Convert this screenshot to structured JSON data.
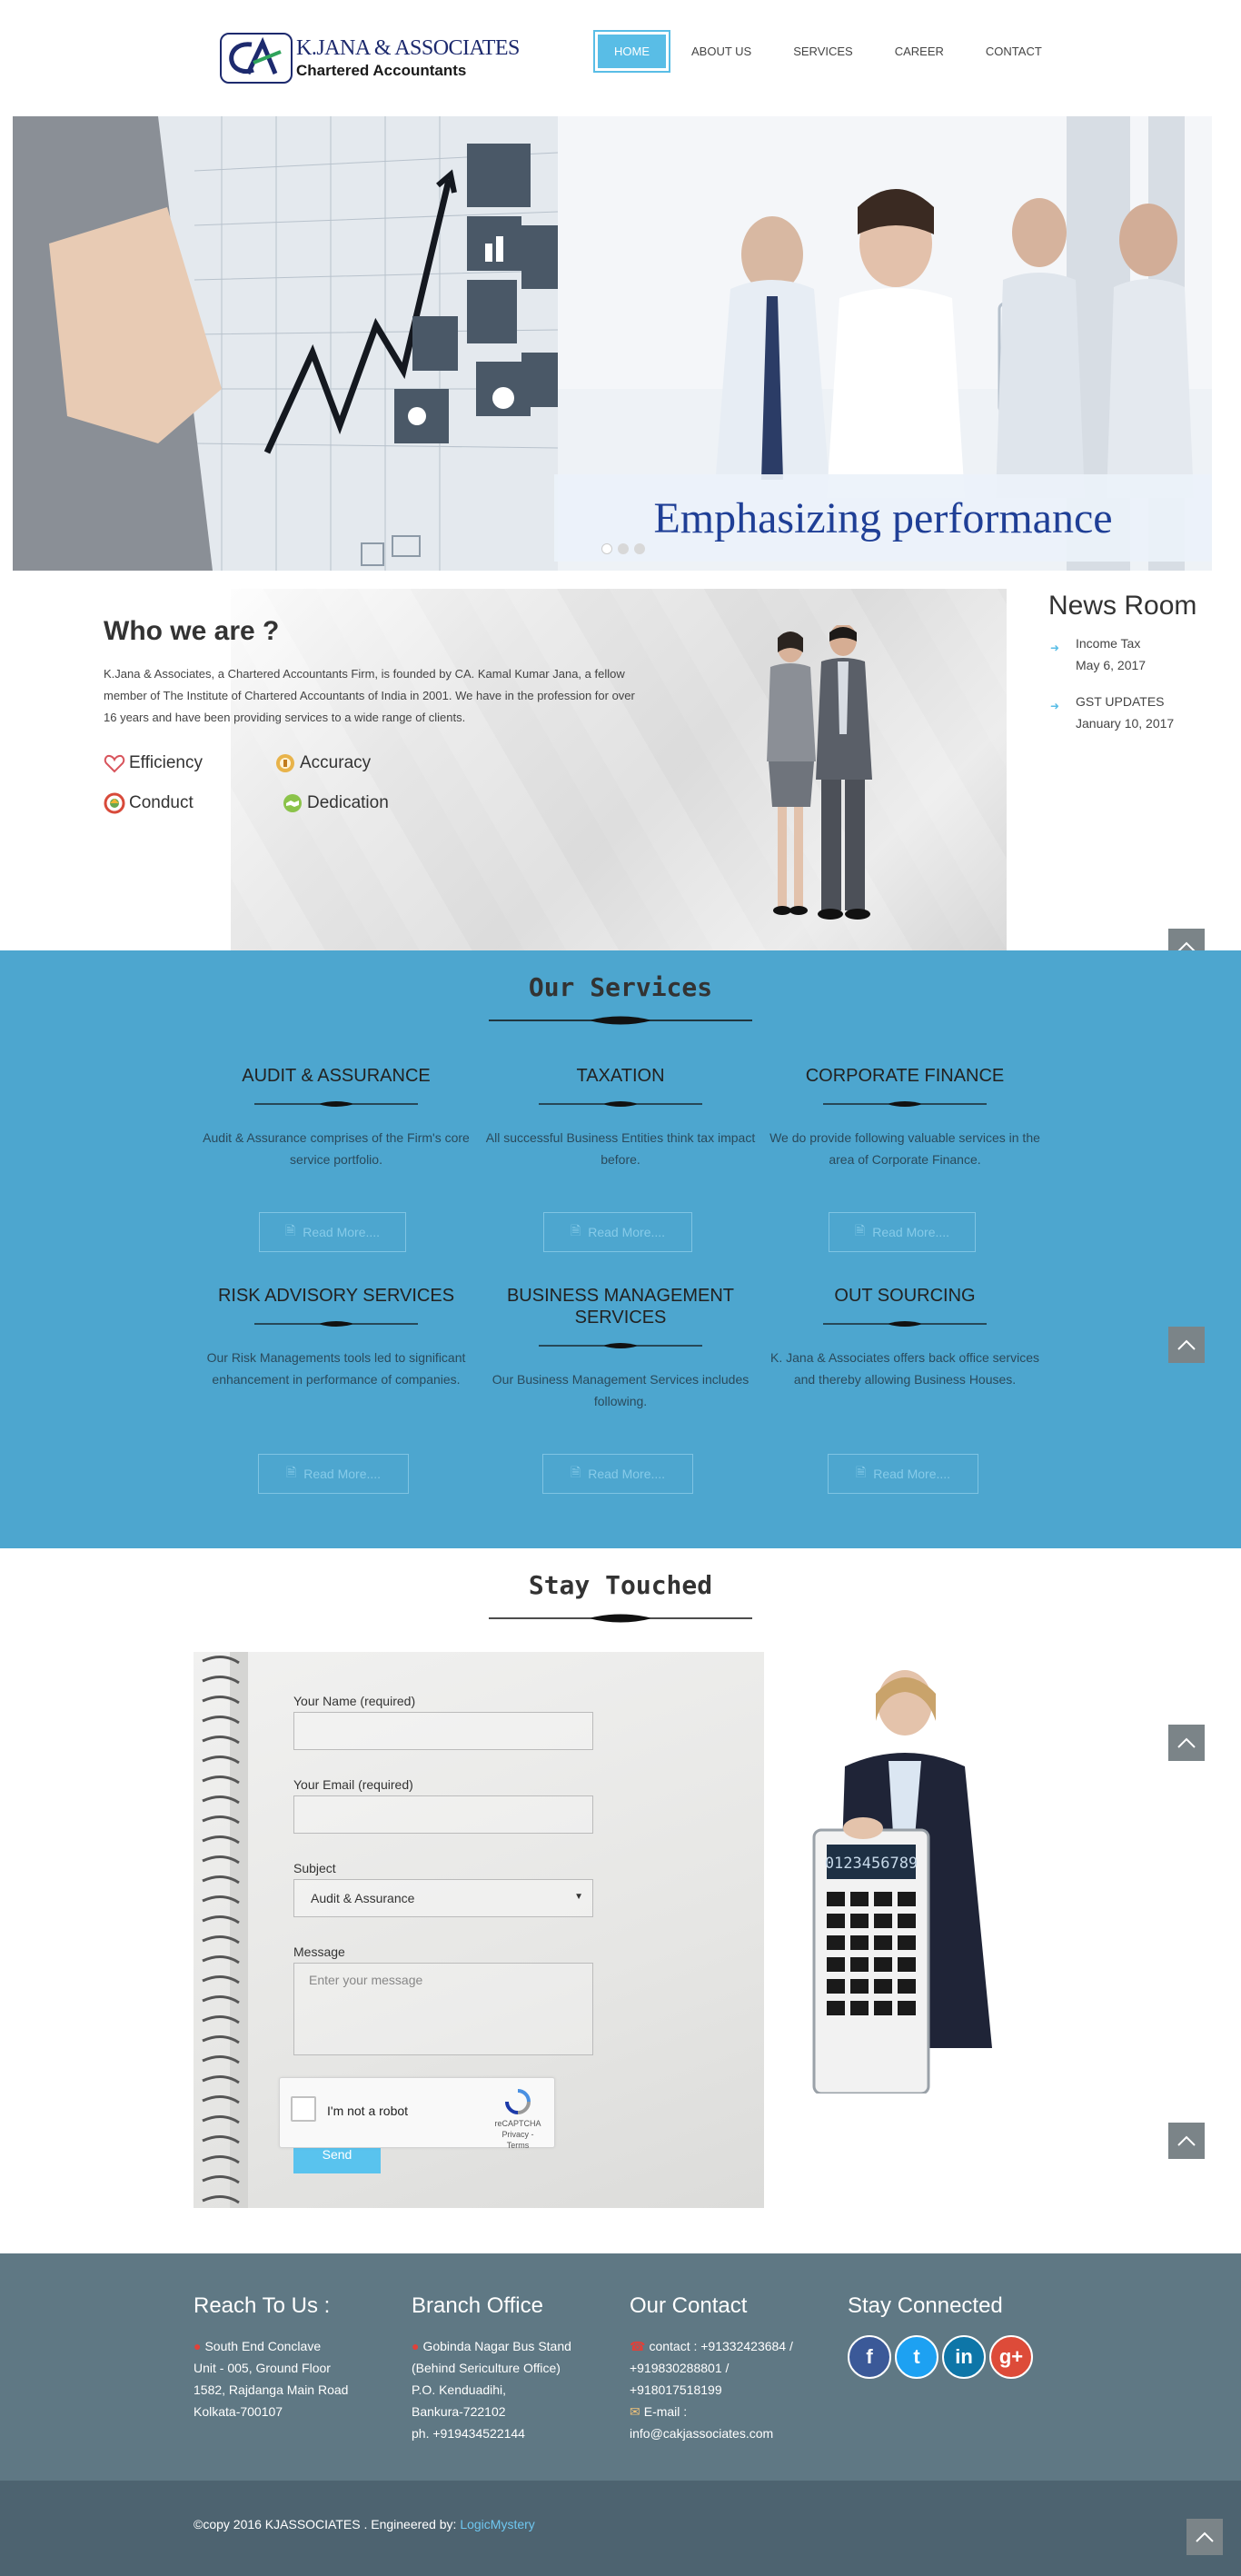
{
  "header": {
    "logo_mark": "CA",
    "logo_name": "K.JANA & ASSOCIATES",
    "logo_sub": "Chartered Accountants",
    "nav": [
      {
        "label": "HOME",
        "active": true
      },
      {
        "label": "ABOUT US",
        "active": false
      },
      {
        "label": "SERVICES",
        "active": false
      },
      {
        "label": "CAREER",
        "active": false
      },
      {
        "label": "CONTACT",
        "active": false
      }
    ]
  },
  "hero": {
    "caption": "Emphasizing performance",
    "slides": 3,
    "active_slide": 1
  },
  "who": {
    "title": "Who we are ?",
    "text": "K.Jana & Associates, a Chartered Accountants Firm, is founded by CA. Kamal Kumar Jana, a fellow member of The Institute of Chartered Accountants of India in 2001. We have in the profession for over 16 years and have been providing services to a wide range of clients.",
    "values": [
      {
        "label": "Efficiency",
        "icon": "heart-icon"
      },
      {
        "label": "Accuracy",
        "icon": "medal-icon"
      },
      {
        "label": "Conduct",
        "icon": "circle-badge-icon"
      },
      {
        "label": "Dedication",
        "icon": "handshake-icon"
      }
    ]
  },
  "newsroom": {
    "title": "News Room",
    "items": [
      {
        "title": "Income Tax",
        "date": "May 6, 2017"
      },
      {
        "title": "GST UPDATES",
        "date": "January 10, 2017"
      }
    ]
  },
  "services": {
    "title": "Our Services",
    "read_more": "Read More....",
    "items": [
      {
        "title": "AUDIT & ASSURANCE",
        "text": "Audit & Assurance comprises of the Firm's core service portfolio."
      },
      {
        "title": "TAXATION",
        "text": "All successful Business Entities think tax impact before."
      },
      {
        "title": "CORPORATE FINANCE",
        "text": "We do provide following valuable services in the area of Corporate Finance."
      },
      {
        "title": "RISK ADVISORY SERVICES",
        "text": "Our Risk Managements tools led to significant enhancement in performance of companies."
      },
      {
        "title": "BUSINESS MANAGEMENT SERVICES",
        "text": "Our Business Management Services includes following."
      },
      {
        "title": "OUT SOURCING",
        "text": "K. Jana & Associates offers back office services and thereby allowing Business Houses."
      }
    ]
  },
  "contact": {
    "title": "Stay Touched",
    "name_label": "Your Name (required)",
    "email_label": "Your Email (required)",
    "subject_label": "Subject",
    "subject_value": "Audit & Assurance",
    "message_label": "Message",
    "message_placeholder": "Enter your message",
    "captcha_label": "I'm not a robot",
    "captcha_brand": "reCAPTCHA",
    "captcha_links": "Privacy - Terms",
    "send": "Send",
    "calculator_display": "0123456789"
  },
  "footer": {
    "reach": {
      "title": "Reach To Us :",
      "lines": [
        "South End Conclave",
        "Unit - 005, Ground Floor",
        "1582, Rajdanga Main Road",
        "Kolkata-700107"
      ]
    },
    "branch": {
      "title": "Branch Office",
      "lines": [
        "Gobinda Nagar Bus Stand",
        "(Behind Sericulture Office)",
        "P.O. Kenduadihi,",
        "Bankura-722102",
        "ph. +919434522144"
      ]
    },
    "contact": {
      "title": "Our Contact",
      "phone_lines": [
        "contact : +91332423684 /",
        "+919830288801 /",
        "+918017518199"
      ],
      "email_label": "E-mail :",
      "email": "info@cakjassociates.com"
    },
    "social": {
      "title": "Stay Connected",
      "items": [
        {
          "glyph": "f",
          "icon": "facebook-icon",
          "color": "#3b5998"
        },
        {
          "glyph": "t",
          "icon": "twitter-icon",
          "color": "#1da1f2"
        },
        {
          "glyph": "in",
          "icon": "linkedin-icon",
          "color": "#0e76a8"
        },
        {
          "glyph": "g+",
          "icon": "google-plus-icon",
          "color": "#dd4b39"
        }
      ]
    },
    "copyright": "©copy 2016 KJASSOCIATES . Engineered by: ",
    "engineer": "LogicMystery"
  },
  "colors": {
    "accent": "#59bde6",
    "services_bg": "#4da6cf",
    "footer_bg": "#5f7884",
    "bottom_bg": "#4d6370",
    "brand": "#1d2a6e",
    "hero_caption": "#1f3f96"
  }
}
